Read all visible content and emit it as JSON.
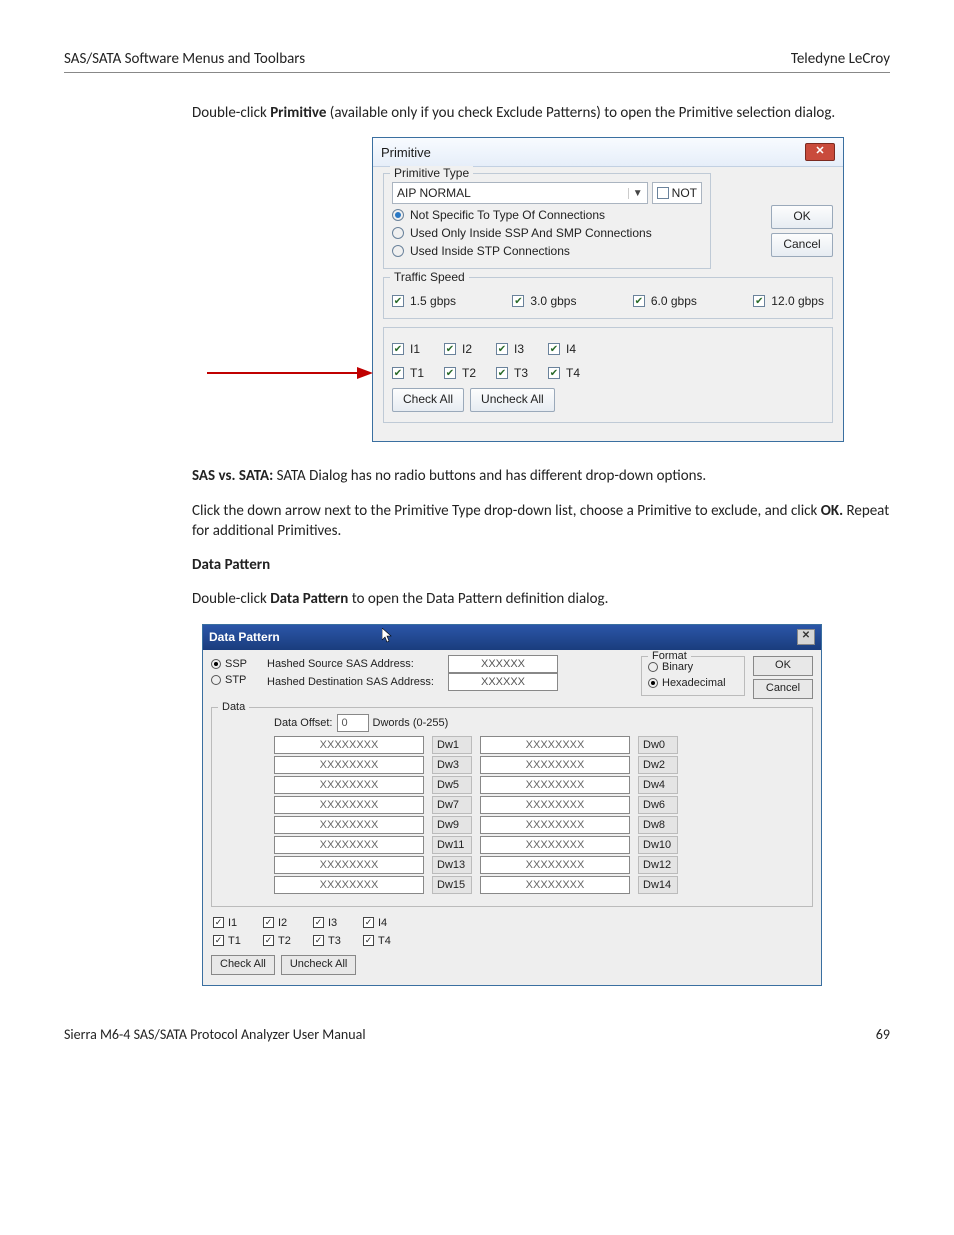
{
  "header": {
    "left": "SAS/SATA Software Menus and Toolbars",
    "right": "Teledyne LeCroy"
  },
  "body": {
    "p1_a": "Double-click ",
    "p1_b": "Primitive",
    "p1_c": " (available only if you check Exclude Patterns) to open the Primitive selection dialog.",
    "p2_a": "SAS vs. SATA:",
    "p2_b": " SATA Dialog has no radio buttons and has different drop-down options.",
    "p3_a": "Click the down arrow next to the Primitive Type drop-down list, choose a Primitive to exclude, and click ",
    "p3_b": "OK.",
    "p3_c": " Repeat for additional Primitives.",
    "h1": "Data Pattern",
    "p4_a": "Double-click ",
    "p4_b": "Data Pattern",
    "p4_c": " to open the Data Pattern definition dialog."
  },
  "prim": {
    "title": "Primitive",
    "type_legend": "Primitive Type",
    "type_value": "AIP NORMAL",
    "not_label": "NOT",
    "ok": "OK",
    "cancel": "Cancel",
    "r1": "Not Specific To Type Of Connections",
    "r2": "Used Only Inside SSP And SMP Connections",
    "r3": "Used Inside STP Connections",
    "speed_legend": "Traffic Speed",
    "speeds": [
      "1.5 gbps",
      "3.0 gbps",
      "6.0 gbps",
      "12.0 gbps"
    ],
    "ports_i": [
      "I1",
      "I2",
      "I3",
      "I4"
    ],
    "ports_t": [
      "T1",
      "T2",
      "T3",
      "T4"
    ],
    "check_all": "Check All",
    "uncheck_all": "Uncheck All"
  },
  "dp": {
    "title": "Data Pattern",
    "ssp": "SSP",
    "stp": "STP",
    "src_label": "Hashed Source SAS Address:",
    "dst_label": "Hashed Destination SAS Address:",
    "addr_val": "XXXXXX",
    "format_legend": "Format",
    "binary": "Binary",
    "hex": "Hexadecimal",
    "ok": "OK",
    "cancel": "Cancel",
    "data_legend": "Data",
    "offset_label": "Data Offset:",
    "offset_val": "0",
    "offset_range": "Dwords (0-255)",
    "dw_val": "XXXXXXXX",
    "rows": [
      {
        "l": "Dw1",
        "r": "Dw0"
      },
      {
        "l": "Dw3",
        "r": "Dw2"
      },
      {
        "l": "Dw5",
        "r": "Dw4"
      },
      {
        "l": "Dw7",
        "r": "Dw6"
      },
      {
        "l": "Dw9",
        "r": "Dw8"
      },
      {
        "l": "Dw11",
        "r": "Dw10"
      },
      {
        "l": "Dw13",
        "r": "Dw12"
      },
      {
        "l": "Dw15",
        "r": "Dw14"
      }
    ],
    "ports_i": [
      "I1",
      "I2",
      "I3",
      "I4"
    ],
    "ports_t": [
      "T1",
      "T2",
      "T3",
      "T4"
    ],
    "check_all": "Check All",
    "uncheck_all": "Uncheck All"
  },
  "footer": {
    "left": "Sierra M6-4 SAS/SATA Protocol Analyzer User Manual",
    "right": "69"
  }
}
